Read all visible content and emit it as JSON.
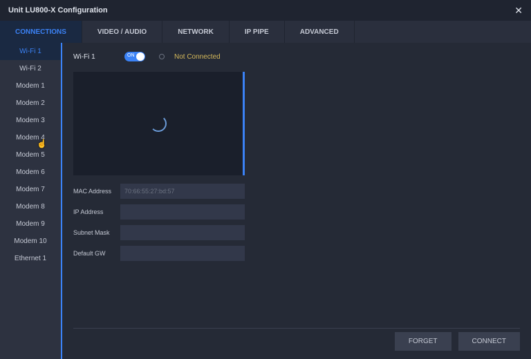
{
  "window": {
    "title": "Unit LU800-X Configuration"
  },
  "tabs": [
    {
      "label": "CONNECTIONS",
      "active": true
    },
    {
      "label": "VIDEO / AUDIO"
    },
    {
      "label": "NETWORK"
    },
    {
      "label": "IP PIPE"
    },
    {
      "label": "ADVANCED"
    }
  ],
  "sidebar": {
    "items": [
      {
        "label": "Wi-Fi 1",
        "active": true
      },
      {
        "label": "Wi-Fi 2"
      },
      {
        "label": "Modem 1"
      },
      {
        "label": "Modem 2"
      },
      {
        "label": "Modem 3"
      },
      {
        "label": "Modem 4"
      },
      {
        "label": "Modem 5"
      },
      {
        "label": "Modem 6"
      },
      {
        "label": "Modem 7"
      },
      {
        "label": "Modem 8"
      },
      {
        "label": "Modem 9"
      },
      {
        "label": "Modem 10"
      },
      {
        "label": "Ethernet 1"
      }
    ]
  },
  "connection": {
    "name": "Wi-Fi 1",
    "toggle": "ON",
    "status": "Not Connected",
    "fields": {
      "mac_label": "MAC Address",
      "mac_value": "70:66:55:27:bd:57",
      "ip_label": "IP Address",
      "ip_value": "",
      "subnet_label": "Subnet Mask",
      "subnet_value": "",
      "gw_label": "Default GW",
      "gw_value": ""
    }
  },
  "buttons": {
    "forget": "FORGET",
    "connect": "CONNECT"
  }
}
